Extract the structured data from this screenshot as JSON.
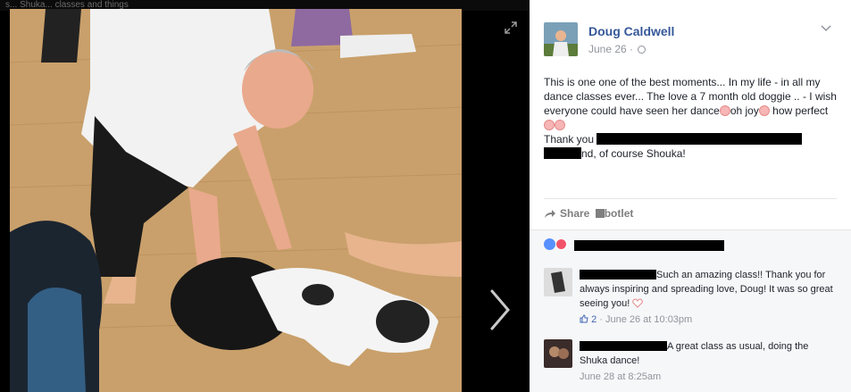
{
  "photo_viewer": {
    "top_strip_text": "s... Shuka... classes and things"
  },
  "post": {
    "author": "Doug Caldwell",
    "date": "June 26",
    "text_line_1": "This is one one of the best moments... In my life - in all my dance classes ever... The love a 7 month old doggie .. - I wish everyone could have seen her dance",
    "oh_joy": "oh joy",
    "how_perfect": " how perfect",
    "thank_you": "Thank you ",
    "closing": "nd, of course Shouka!"
  },
  "actions": {
    "share_label": "Share",
    "botlet_label": "botlet"
  },
  "comments": [
    {
      "text": "Such an amazing class!! Thank you for always inspiring and spreading love, Doug! It was so great seeing you!",
      "likes": "2",
      "timestamp": "June 26 at 10:03pm"
    },
    {
      "text": "A great class as usual, doing the Shuka dance!",
      "timestamp": "June 28 at 8:25am"
    }
  ],
  "colors": {
    "link_blue": "#365899",
    "meta_gray": "#90949c",
    "like_blue": "#5890ff",
    "love_red": "#f25268"
  },
  "icons": [
    "expand-icon",
    "next-arrow-icon",
    "globe-icon",
    "chevron-down-icon",
    "share-arrow-icon",
    "like-reaction-icon",
    "love-reaction-icon",
    "thumbs-up-icon",
    "heart-icon"
  ]
}
